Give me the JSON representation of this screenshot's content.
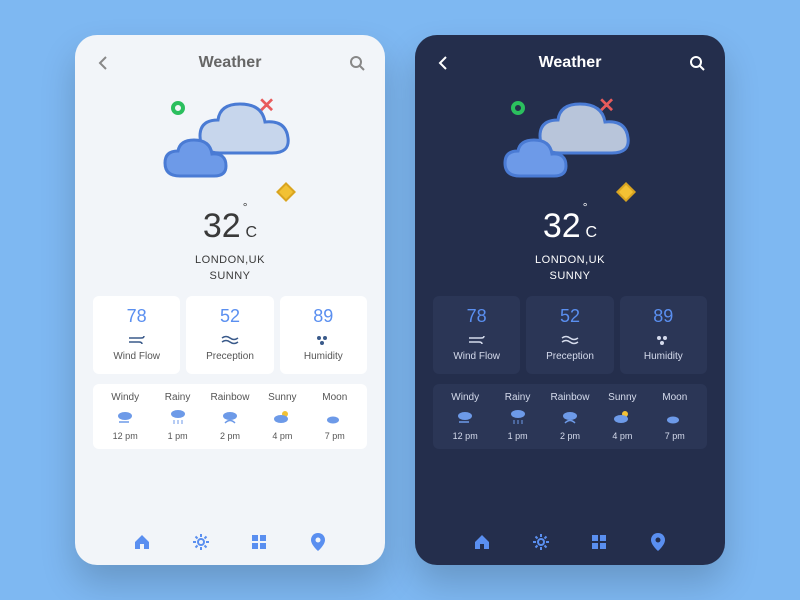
{
  "header": {
    "title": "Weather"
  },
  "temperature": {
    "value": "32",
    "unit": "C"
  },
  "location": "LONDON,UK",
  "condition": "SUNNY",
  "stats": [
    {
      "value": "78",
      "label": "Wind Flow",
      "icon": "wind"
    },
    {
      "value": "52",
      "label": "Preception",
      "icon": "waves"
    },
    {
      "value": "89",
      "label": "Humidity",
      "icon": "drops"
    }
  ],
  "forecast": [
    {
      "label": "Windy",
      "time": "12 pm",
      "icon": "windy"
    },
    {
      "label": "Rainy",
      "time": "1 pm",
      "icon": "rainy"
    },
    {
      "label": "Rainbow",
      "time": "2 pm",
      "icon": "rainbow"
    },
    {
      "label": "Sunny",
      "time": "4 pm",
      "icon": "sunny"
    },
    {
      "label": "Moon",
      "time": "7 pm",
      "icon": "moon"
    }
  ],
  "colors": {
    "accent": "#5a8ff0"
  }
}
